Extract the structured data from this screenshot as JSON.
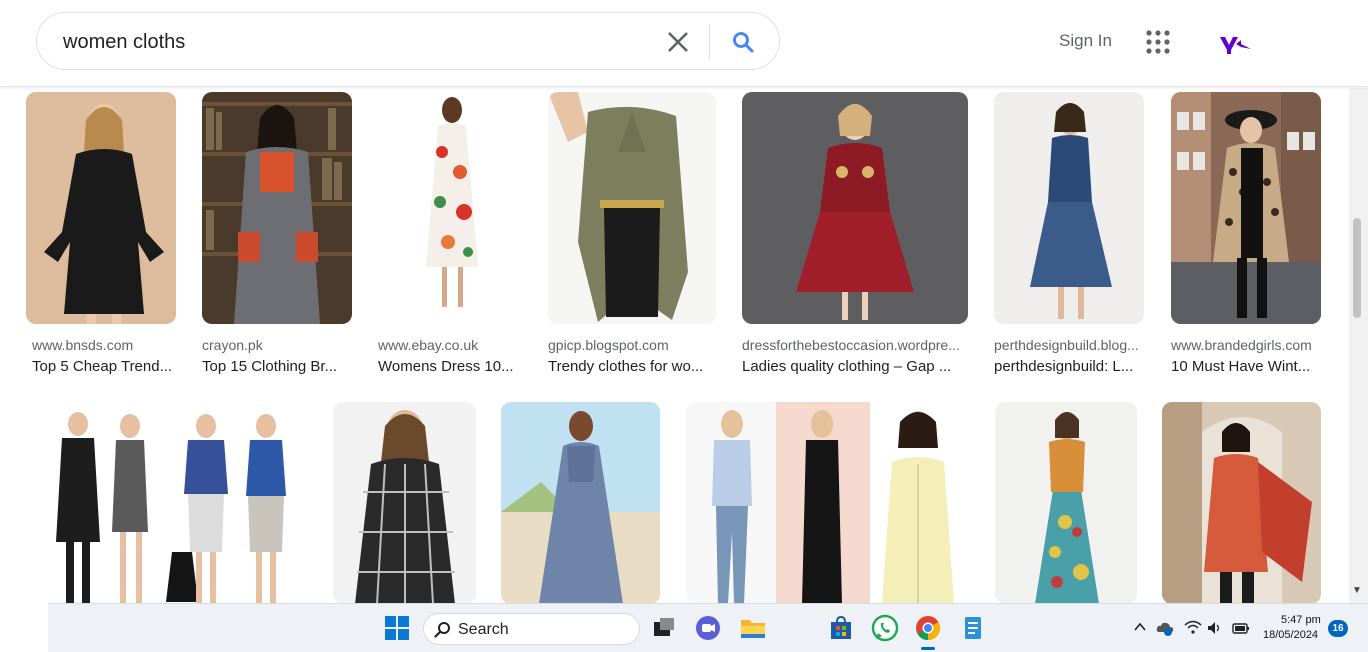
{
  "search": {
    "query": "women cloths"
  },
  "header": {
    "sign_in": "Sign In"
  },
  "row1": [
    {
      "source": "www.bnsds.com",
      "title": "Top 5 Cheap Trend..."
    },
    {
      "source": "crayon.pk",
      "title": "Top 15 Clothing Br..."
    },
    {
      "source": "www.ebay.co.uk",
      "title": "Womens Dress 10..."
    },
    {
      "source": "gpicp.blogspot.com",
      "title": "Trendy clothes for wo..."
    },
    {
      "source": "dressforthebestoccasion.wordpre...",
      "title": "Ladies quality clothing – Gap ..."
    },
    {
      "source": "perthdesignbuild.blog...",
      "title": "perthdesignbuild: L..."
    },
    {
      "source": "www.brandedgirls.com",
      "title": "10 Must Have Wint..."
    }
  ],
  "taskbar": {
    "search_label": "Search",
    "time": "5:47 pm",
    "date": "18/05/2024",
    "notification_count": "16"
  },
  "colors": {
    "google_blue": "#4285f4",
    "yahoo_purple": "#6001d2",
    "taskbar_bg": "#eef2f7"
  },
  "icons": [
    "close-icon",
    "search-icon",
    "apps-grid-icon",
    "yahoo-logo",
    "windows-start-icon",
    "task-view-icon",
    "chat-icon",
    "file-explorer-icon",
    "store-icon",
    "whatsapp-icon",
    "chrome-icon",
    "notepad-icon",
    "chevron-up-icon",
    "onedrive-icon",
    "wifi-icon",
    "volume-icon",
    "battery-icon"
  ]
}
